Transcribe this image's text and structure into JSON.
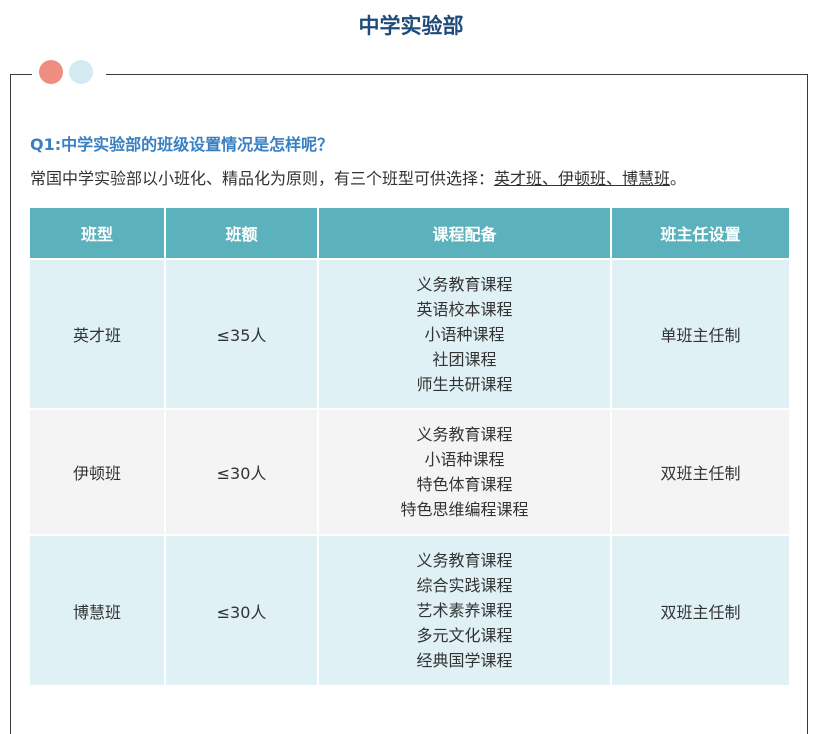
{
  "header": {
    "title": "中学实验部"
  },
  "colors": {
    "title": "#1f4b7a",
    "question": "#3a7fc1",
    "table_header": "#5bb1bc",
    "row_blue": "#dff1f4",
    "row_grey": "#f4f4f4",
    "dot_coral": "#ef8e80",
    "dot_blue": "#d4eaf2"
  },
  "question": "Q1:中学实验部的班级设置情况是怎样呢？",
  "intro": {
    "prefix": "常国中学实验部以小班化、精品化为原则，有三个班型可供选择：",
    "highlight": "英才班、伊顿班、博慧班",
    "suffix": "。"
  },
  "table": {
    "headers": [
      "班型",
      "班额",
      "课程配备",
      "班主任设置"
    ],
    "rows": [
      {
        "type": "英才班",
        "size": "≤35人",
        "courses": [
          "义务教育课程",
          "英语校本课程",
          "小语种课程",
          "社团课程",
          "师生共研课程"
        ],
        "teacher": "单班主任制"
      },
      {
        "type": "伊顿班",
        "size": "≤30人",
        "courses": [
          "义务教育课程",
          "小语种课程",
          "特色体育课程",
          "特色思维编程课程"
        ],
        "teacher": "双班主任制"
      },
      {
        "type": "博慧班",
        "size": "≤30人",
        "courses": [
          "义务教育课程",
          "综合实践课程",
          "艺术素养课程",
          "多元文化课程",
          "经典国学课程"
        ],
        "teacher": "双班主任制"
      }
    ]
  }
}
